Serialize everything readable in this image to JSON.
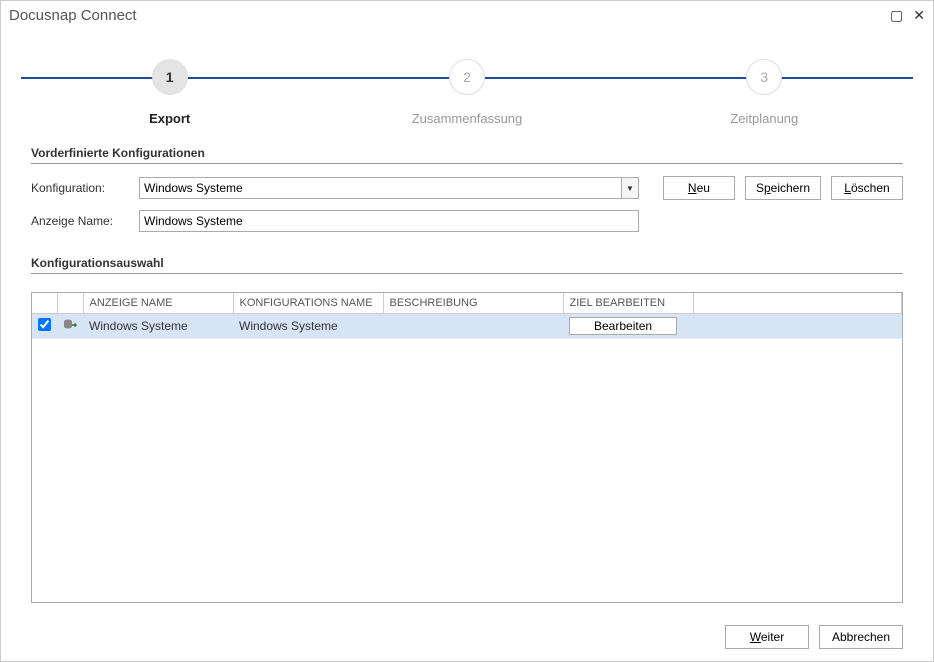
{
  "window": {
    "title": "Docusnap Connect"
  },
  "wizard": {
    "steps": [
      {
        "num": "1",
        "label": "Export",
        "active": true
      },
      {
        "num": "2",
        "label": "Zusammenfassung",
        "active": false
      },
      {
        "num": "3",
        "label": "Zeitplanung",
        "active": false
      }
    ]
  },
  "section_predefined": {
    "title": "Vorderfinierte Konfigurationen",
    "config_label": "Konfiguration:",
    "config_value": "Windows Systeme",
    "display_label": "Anzeige Name:",
    "display_value": "Windows Systeme",
    "buttons": {
      "new": "Neu",
      "save": "Speichern",
      "delete": "Löschen"
    }
  },
  "section_selection": {
    "title": "Konfigurationsauswahl",
    "columns": {
      "display_name": "ANZEIGE NAME",
      "config_name": "KONFIGURATIONS NAME",
      "description": "BESCHREIBUNG",
      "edit_target": "ZIEL BEARBEITEN"
    },
    "rows": [
      {
        "checked": true,
        "display_name": "Windows Systeme",
        "config_name": "Windows Systeme",
        "description": "",
        "edit_label": "Bearbeiten"
      }
    ]
  },
  "footer": {
    "next": "Weiter",
    "cancel": "Abbrechen"
  }
}
